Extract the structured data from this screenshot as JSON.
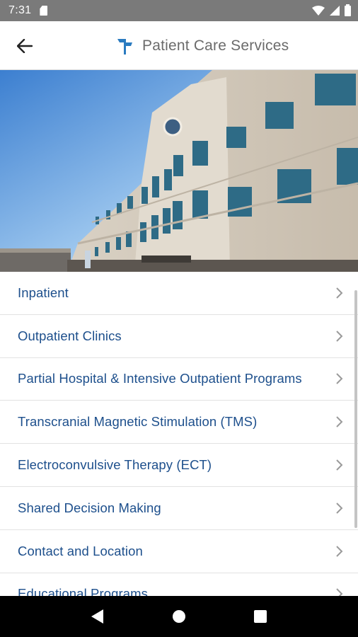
{
  "status_bar": {
    "time": "7:31",
    "icons": [
      "sd-card-icon",
      "wifi-icon",
      "signal-icon",
      "battery-icon"
    ]
  },
  "app_bar": {
    "title": "Patient Care Services",
    "back_icon": "arrow-back-icon",
    "logo_icon": "signpost-logo-icon"
  },
  "hero": {
    "image": "medical-building-photo"
  },
  "menu": {
    "items": [
      {
        "label": "Inpatient"
      },
      {
        "label": "Outpatient Clinics"
      },
      {
        "label": "Partial Hospital & Intensive Outpatient Programs"
      },
      {
        "label": "Transcranial Magnetic Stimulation (TMS)"
      },
      {
        "label": "Electroconvulsive Therapy (ECT)"
      },
      {
        "label": "Shared Decision Making"
      },
      {
        "label": "Contact and Location"
      },
      {
        "label": "Educational Programs"
      }
    ]
  },
  "nav_bar": {
    "icons": [
      "nav-back-icon",
      "nav-home-icon",
      "nav-recents-icon"
    ]
  },
  "colors": {
    "status_bar": "#7a7a7a",
    "menu_text": "#1d4f8c",
    "title_text": "#6b6b6b",
    "logo_blue": "#2a7bc0",
    "divider": "#e2e2e2",
    "nav_bar": "#000000"
  }
}
